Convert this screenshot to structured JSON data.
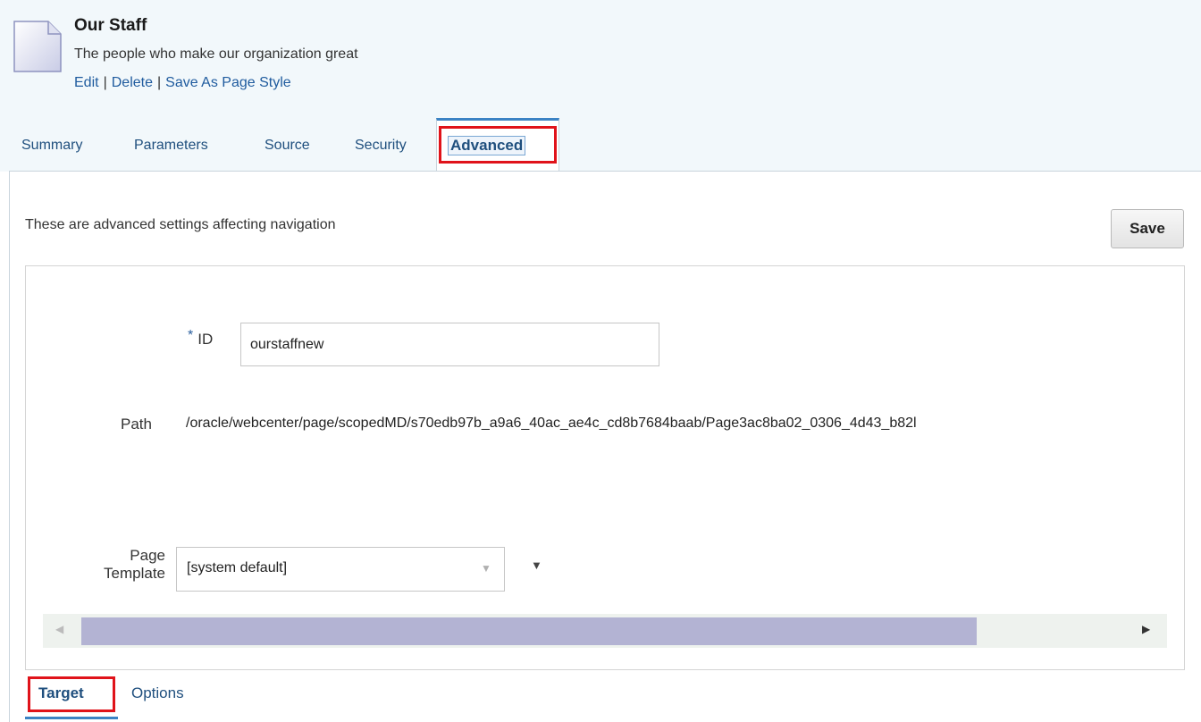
{
  "page": {
    "title": "Our Staff",
    "subtitle": "The people who make our organization great",
    "actions": {
      "edit": "Edit",
      "delete": "Delete",
      "save_as_style": "Save As Page Style",
      "separator": "|"
    }
  },
  "tabs": [
    "Summary",
    "Parameters",
    "Source",
    "Security",
    "Advanced"
  ],
  "active_tab": "Advanced",
  "intro_text": "These are advanced settings affecting navigation",
  "save_label": "Save",
  "fields": {
    "id": {
      "required_mark": "*",
      "label": "ID",
      "value": "ourstaffnew"
    },
    "path": {
      "label": "Path",
      "value": "/oracle/webcenter/page/scopedMD/s70edb97b_a9a6_40ac_ae4c_cd8b7684baab/Page3ac8ba02_0306_4d43_b82l"
    },
    "page_template": {
      "label_line1": "Page",
      "label_line2": "Template",
      "value": "[system default]"
    }
  },
  "bottom_tabs": [
    "Target",
    "Options"
  ],
  "active_bottom_tab": "Target",
  "icons": {
    "page": "page-document-icon",
    "dropdown": "chevron-down-icon",
    "menu": "dropdown-menu-icon",
    "scroll_left": "scroll-left-icon",
    "scroll_right": "scroll-right-icon"
  },
  "colors": {
    "link": "#1f4f7e",
    "highlight": "#e0131a",
    "tab_accent": "#3b83c4",
    "header_bg": "#f2f8fb",
    "scroll_thumb": "#b3b3d3"
  }
}
